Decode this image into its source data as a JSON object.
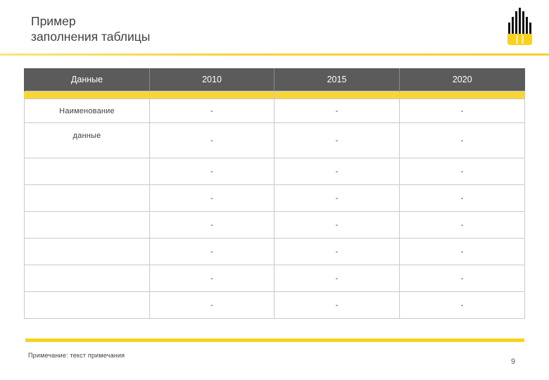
{
  "slide": {
    "title_line1": "Пример",
    "title_line2": "заполнения таблицы",
    "note": "Примечание: текст примечания",
    "page_number": "9",
    "colors": {
      "accent": "#f8d21c",
      "header_bg": "#5b5b5b",
      "row_alt": "#f2f2f2"
    }
  },
  "table": {
    "headers": [
      "Данные",
      "2010",
      "2015",
      "2020"
    ],
    "rows": [
      [
        "Наименование",
        "-",
        "-",
        "-"
      ],
      [
        "данные",
        "-",
        "-",
        "-"
      ],
      [
        "",
        "-",
        "-",
        "-"
      ],
      [
        "",
        "-",
        "-",
        "-"
      ],
      [
        "",
        "-",
        "-",
        "-"
      ],
      [
        "",
        "-",
        "-",
        "-"
      ],
      [
        "",
        "-",
        "-",
        "-"
      ],
      [
        "",
        "-",
        "-",
        "-"
      ]
    ]
  },
  "logo": {
    "icon": "company-logo-icon"
  }
}
